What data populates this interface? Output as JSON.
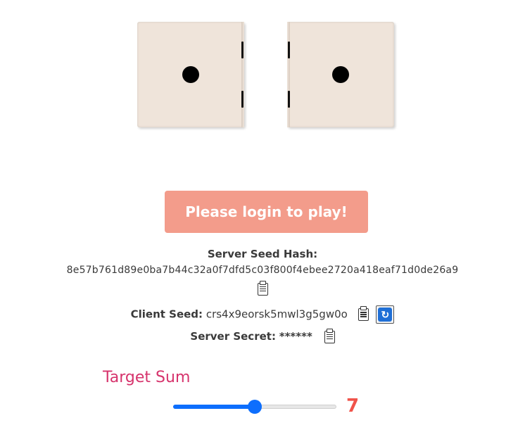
{
  "dice": {
    "left_value": 1,
    "right_value": 1
  },
  "play_button": {
    "label": "Please login to play!"
  },
  "seeds": {
    "server_seed_hash_label": "Server Seed Hash:",
    "server_seed_hash_value": "8e57b761d89e0ba7b44c32a0f7dfd5c03f800f4ebee2720a418eaf71d0de26a9",
    "client_seed_label": "Client Seed:",
    "client_seed_value": "crs4x9eorsk5mwl3g5gw0o",
    "server_secret_label": "Server Secret:",
    "server_secret_value": "******"
  },
  "target": {
    "label": "Target Sum",
    "value": "7",
    "slider_min": 2,
    "slider_max": 12,
    "slider_value": 7
  },
  "colors": {
    "accent": "#0d6efd",
    "play_button_bg": "#f39c8b",
    "target_label": "#d6336c",
    "target_value": "#f0534a",
    "die_face": "#efe4da"
  },
  "icons": {
    "copy": "clipboard-icon",
    "refresh": "refresh-icon"
  }
}
